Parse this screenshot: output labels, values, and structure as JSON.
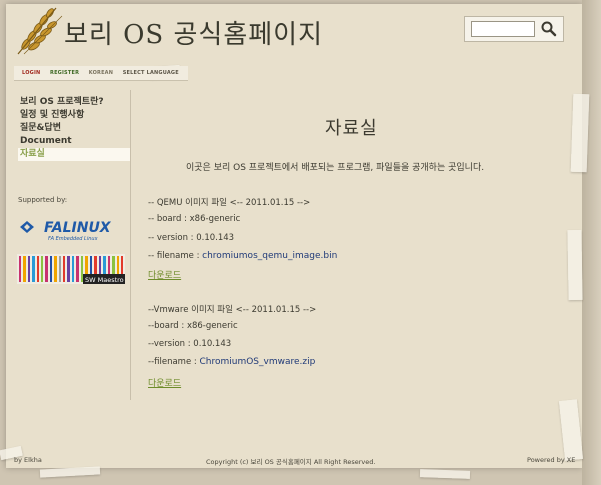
{
  "header": {
    "site_title": "보리 OS 공식홈페이지",
    "search_placeholder": ""
  },
  "topnav": {
    "login": "LOGIN",
    "register": "REGISTER",
    "korean": "KOREAN",
    "select_language": "SELECT LANGUAGE"
  },
  "sidebar": {
    "items": [
      {
        "label": "보리 OS 프로젝트란?"
      },
      {
        "label": "일정 및 진행사항"
      },
      {
        "label": "질문&답변"
      },
      {
        "label": "Document"
      },
      {
        "label": "자료실"
      }
    ],
    "supported_by": "Supported by:",
    "falinux_text": "FALINUX",
    "falinux_sub": "FA Embedded Linux",
    "swm_text": "SW Maestro"
  },
  "main": {
    "title": "자료실",
    "intro": "이곳은 보리 OS 프로젝트에서 배포되는 프로그램, 파일들을 공개하는 곳입니다.",
    "qemu": {
      "heading": "-- QEMU 이미지 파일  <-- 2011.01.15 -->",
      "board": "-- board : x86-generic",
      "version": "-- version : 0.10.143",
      "filename_label": "-- filename :",
      "filename": "chromiumos_qemu_image.bin",
      "download": "다운로드"
    },
    "vmware": {
      "heading": "--Vmware 이미지 파일 <-- 2011.01.15 -->",
      "board": "--board : x86-generic",
      "version": "--version : 0.10.143",
      "filename_label": "--filename :",
      "filename": "ChromiumOS_vmware.zip",
      "download": "다운로드"
    }
  },
  "footer": {
    "left": "by Elkha",
    "center": "Copyright (c) 보리 OS 공식홈페이지 All Right Reserved.",
    "right": "Powered by XE"
  }
}
